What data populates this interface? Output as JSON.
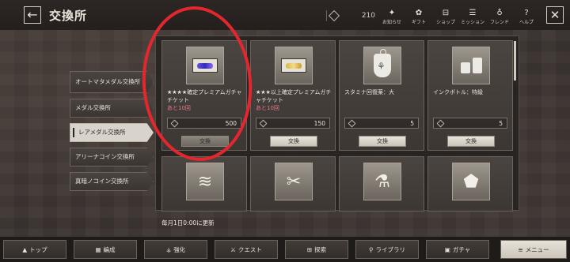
{
  "header": {
    "title": "交換所",
    "back_icon": "back-arrow-icon",
    "points_value": "210",
    "nav": [
      {
        "label": "お知らせ",
        "icon": "✦"
      },
      {
        "label": "ギフト",
        "icon": "✿"
      },
      {
        "label": "ショップ",
        "icon": "⊟"
      },
      {
        "label": "ミッション",
        "icon": "☰"
      },
      {
        "label": "フレンド",
        "icon": "♁"
      },
      {
        "label": "ヘルプ",
        "icon": "?"
      }
    ]
  },
  "sidebar": {
    "items": [
      {
        "label": "オートマタメダル交換所",
        "active": false
      },
      {
        "label": "メダル交換所",
        "active": false
      },
      {
        "label": "レアメダル交換所",
        "active": true
      },
      {
        "label": "アリーナコイン交換所",
        "active": false
      },
      {
        "label": "真暗ノコイン交換所",
        "active": false
      }
    ]
  },
  "cards": [
    {
      "name": "★★★★確定プレミアムガチャチケット",
      "remaining": "あと10回",
      "price": "500",
      "button": "交換",
      "icon": "premium-ticket-icon"
    },
    {
      "name": "★★★以上確定プレミアムガチャチケット",
      "remaining": "あと10回",
      "price": "150",
      "button": "交換",
      "icon": "gold-ticket-icon"
    },
    {
      "name": "スタミナ回復薬：大",
      "remaining": "",
      "price": "5",
      "button": "交換",
      "icon": "stamina-potion-icon"
    },
    {
      "name": "インクボトル：特級",
      "remaining": "",
      "price": "5",
      "button": "交換",
      "icon": "ink-bottle-icon"
    }
  ],
  "footer_note": "毎月1日0:00に更新",
  "bottom_nav": [
    {
      "label": "トップ",
      "icon": "▲"
    },
    {
      "label": "編成",
      "icon": "▦"
    },
    {
      "label": "強化",
      "icon": "⚶"
    },
    {
      "label": "クエスト",
      "icon": "⚔"
    },
    {
      "label": "探索",
      "icon": "⊞"
    },
    {
      "label": "ライブラリ",
      "icon": "⚲"
    },
    {
      "label": "ガチャ",
      "icon": "▣"
    },
    {
      "label": "メニュー",
      "icon": "≡"
    }
  ]
}
